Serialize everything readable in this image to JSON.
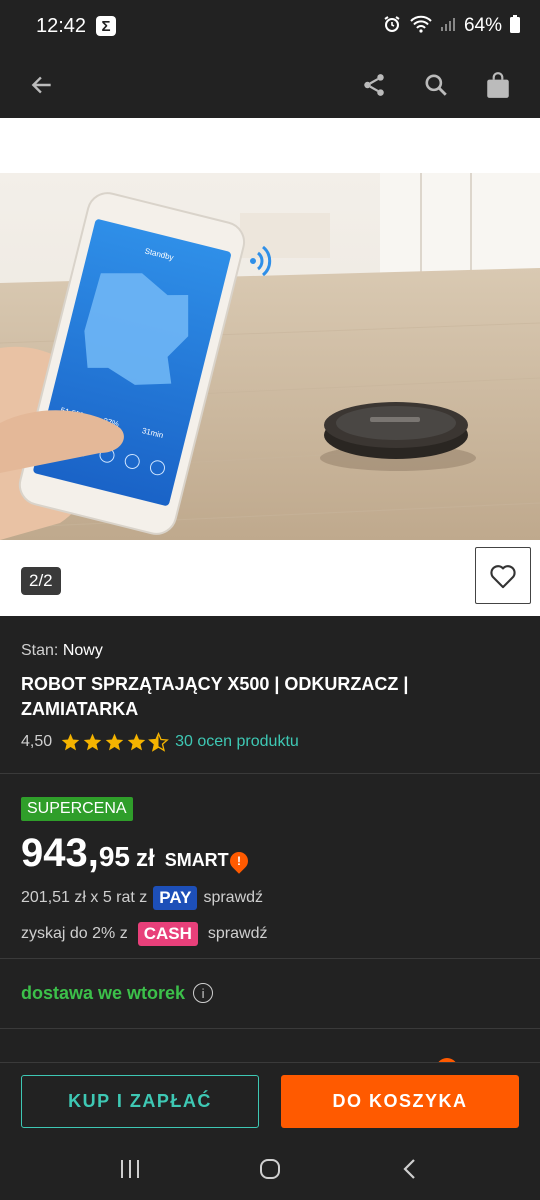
{
  "status": {
    "time": "12:42",
    "app_badge": "Σ",
    "battery": "64%"
  },
  "toolbar": {
    "back": "back",
    "share": "share",
    "search": "search",
    "cart": "cart"
  },
  "image": {
    "counter": "2/2",
    "phone_status": "Standby",
    "phone_stat1": "51.5ft²",
    "phone_stat2": "37%",
    "phone_stat3": "31min"
  },
  "product": {
    "condition_label": "Stan:",
    "condition_value": "Nowy",
    "title": "ROBOT SPRZĄTAJĄCY X500 | ODKURZACZ | ZAMIATARKA",
    "rating_value": "4,50",
    "rating_stars": 4.5,
    "reviews": "30 ocen produktu"
  },
  "price": {
    "badge": "SUPERCENA",
    "integer": "943,",
    "decimal": "95",
    "currency": "zł",
    "smart": "SMART",
    "smart_mark": "!",
    "installment_text": "201,51 zł x 5 rat z",
    "pay_badge": "PAY",
    "installment_link": "sprawdź",
    "cash_text": "zyskaj do 2% z",
    "cash_badge": "CASH",
    "cash_link": "sprawdź"
  },
  "delivery": {
    "text": "dostawa we wtorek",
    "info": "i"
  },
  "actions": {
    "buy": "KUP I ZAPŁAĆ",
    "cart": "DO KOSZYKA"
  },
  "colors": {
    "accent_teal": "#3ec8b4",
    "accent_orange": "#ff5a00",
    "green": "#3cc04a",
    "star": "#f5b400"
  }
}
